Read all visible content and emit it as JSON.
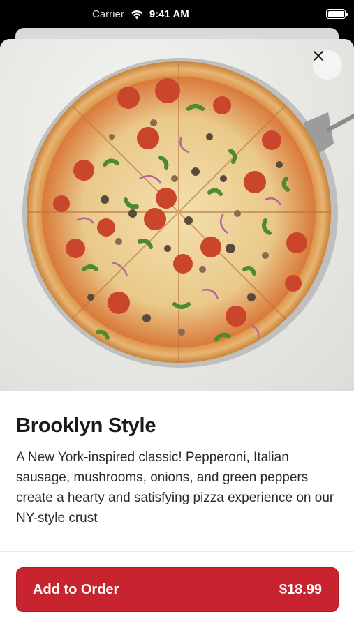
{
  "status_bar": {
    "carrier": "Carrier",
    "time": "9:41 AM",
    "icons": [
      "wifi-icon",
      "battery-icon"
    ]
  },
  "product": {
    "image_icon": "pizza-image",
    "title": "Brooklyn Style",
    "description": "A New York-inspired classic! Pepperoni, Italian sausage, mushrooms, onions, and green peppers create a hearty and satisfying pizza experience on our NY-style crust"
  },
  "close_icon": "close-icon",
  "order": {
    "add_label": "Add to Order",
    "price": "$18.99"
  },
  "colors": {
    "accent": "#c8242f",
    "text": "#1a1a1a"
  }
}
